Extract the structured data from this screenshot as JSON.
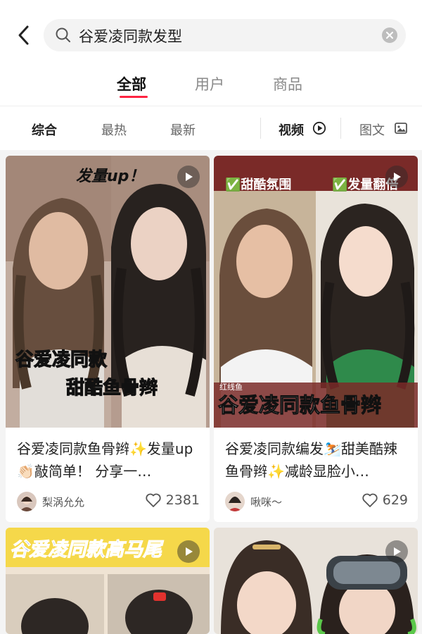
{
  "search": {
    "query": "谷爱凌同款发型"
  },
  "tabs": [
    {
      "label": "全部",
      "active": true
    },
    {
      "label": "用户",
      "active": false
    },
    {
      "label": "商品",
      "active": false
    }
  ],
  "filters": {
    "sort": [
      "综合",
      "最热",
      "最新"
    ],
    "video": "视频",
    "image_text": "图文"
  },
  "cards": [
    {
      "title": "谷爱凌同款鱼骨辫✨发量up👏🏻敲简单！ 分享一…",
      "author": "梨涡允允",
      "likes": "2381",
      "overlay": {
        "top": "发量up！",
        "bottom1": "谷爱凌同款",
        "bottom2": "甜酷鱼骨辫"
      }
    },
    {
      "title": "谷爱凌同款编发⛷️甜美酷辣鱼骨辫✨减龄显脸小…",
      "author": "啾咪～",
      "likes": "629",
      "overlay": {
        "tag1": "✅甜酷氛围",
        "tag2": "✅发量翻倍",
        "bottom": "谷爱凌同款鱼骨辫",
        "small": "红线鱼"
      }
    },
    {
      "overlay": {
        "top": "谷爱凌同款高马尾"
      }
    },
    {
      "overlay": {}
    }
  ],
  "colors": {
    "accent": "#ff2442",
    "tag_green": "#2bb24c",
    "banner_blue": "#3a5bd9"
  }
}
